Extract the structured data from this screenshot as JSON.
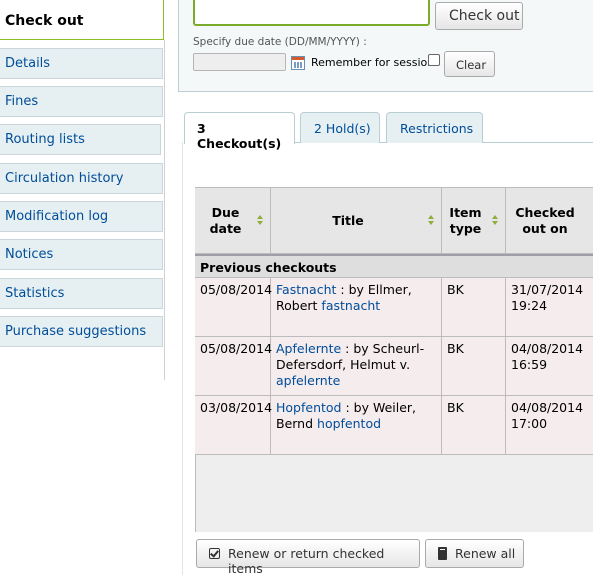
{
  "sidebar": {
    "active": "Check out",
    "items": [
      "Details",
      "Fines",
      "Routing lists",
      "Circulation history",
      "Modification log",
      "Notices",
      "Statistics",
      "Purchase suggestions"
    ]
  },
  "checkout": {
    "barcode_value": "",
    "button_label": "Check out",
    "due_date_label": "Specify due date (DD/MM/YYYY) :",
    "due_date_value": "",
    "remember_label": "Remember for session:",
    "remember_checked": false,
    "clear_label": "Clear"
  },
  "tabs": [
    "3 Checkout(s)",
    "2 Hold(s)",
    "Restrictions"
  ],
  "table": {
    "headers": [
      "Due date",
      "Title",
      "Item type",
      "Checked out on"
    ],
    "group_label": "Previous checkouts",
    "rows": [
      {
        "due": "05/08/2014",
        "title_link": "Fastnacht",
        "title_rest": ": by Ellmer, Robert",
        "title_barcode": "fastnacht",
        "type": "BK",
        "checked_out": "31/07/2014 19:24"
      },
      {
        "due": "05/08/2014",
        "title_link": "Apfelernte",
        "title_rest": ": by Scheurl-Defersdorf, Helmut v.",
        "title_barcode": "apfelernte",
        "type": "BK",
        "checked_out": "04/08/2014 16:59"
      },
      {
        "due": "03/08/2014",
        "title_link": "Hopfentod",
        "title_rest": ": by Weiler, Bernd",
        "title_barcode": "hopfentod",
        "type": "BK",
        "checked_out": "04/08/2014 17:00"
      }
    ]
  },
  "actions": {
    "renew_label": "Renew or return checked items",
    "renew_all_label": "Renew all"
  },
  "colors": {
    "accent_green": "#8cbf26",
    "link": "#004d99",
    "tab_bg": "#e6f0f2"
  }
}
